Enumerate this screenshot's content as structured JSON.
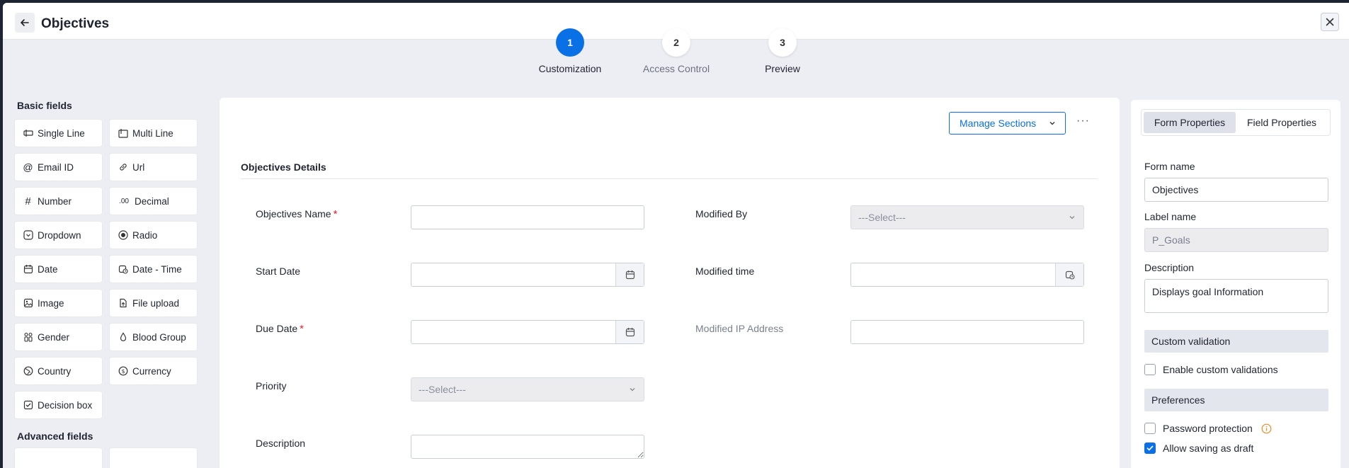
{
  "header": {
    "title": "Objectives"
  },
  "stepper": [
    {
      "number": "1",
      "label": "Customization",
      "state": "active"
    },
    {
      "number": "2",
      "label": "Access Control",
      "state": "inactive"
    },
    {
      "number": "3",
      "label": "Preview",
      "state": "inactive"
    }
  ],
  "left_panel": {
    "basic_title": "Basic fields",
    "advanced_title": "Advanced fields",
    "fields": [
      {
        "label": "Single Line",
        "icon": "single-line-icon"
      },
      {
        "label": "Multi Line",
        "icon": "multi-line-icon"
      },
      {
        "label": "Email ID",
        "icon": "at-icon"
      },
      {
        "label": "Url",
        "icon": "link-icon"
      },
      {
        "label": "Number",
        "icon": "hash-icon"
      },
      {
        "label": "Decimal",
        "icon": "decimal-icon"
      },
      {
        "label": "Dropdown",
        "icon": "dropdown-icon"
      },
      {
        "label": "Radio",
        "icon": "radio-icon"
      },
      {
        "label": "Date",
        "icon": "calendar-icon"
      },
      {
        "label": "Date - Time",
        "icon": "calendar-clock-icon"
      },
      {
        "label": "Image",
        "icon": "image-icon"
      },
      {
        "label": "File upload",
        "icon": "file-upload-icon"
      },
      {
        "label": "Gender",
        "icon": "gender-icon"
      },
      {
        "label": "Blood Group",
        "icon": "drop-icon"
      },
      {
        "label": "Country",
        "icon": "globe-icon"
      },
      {
        "label": "Currency",
        "icon": "currency-icon"
      },
      {
        "label": "Decision box",
        "icon": "checkbox-icon"
      }
    ]
  },
  "form": {
    "manage_sections_label": "Manage Sections",
    "more_label": "···",
    "section_title": "Objectives Details",
    "fields": {
      "objectives_name": "Objectives Name",
      "start_date": "Start Date",
      "due_date": "Due Date",
      "priority": "Priority",
      "description": "Description",
      "modified_by": "Modified By",
      "modified_time": "Modified time",
      "modified_ip": "Modified IP Address"
    },
    "select_placeholder": "---Select---",
    "required_mark": "*"
  },
  "right_panel": {
    "tab_form": "Form Properties",
    "tab_field": "Field Properties",
    "form_name_label": "Form name",
    "form_name_value": "Objectives",
    "label_name_label": "Label name",
    "label_name_value": "P_Goals",
    "description_label": "Description",
    "description_value": "Displays goal Information",
    "custom_validation_title": "Custom validation",
    "enable_custom_validations": "Enable custom validations",
    "preferences_title": "Preferences",
    "password_protection": "Password protection",
    "allow_saving_as_draft": "Allow saving as draft",
    "allow_saving_as_draft_checked": true,
    "password_protection_checked": false,
    "enable_custom_validations_checked": false
  },
  "colors": {
    "accent": "#0a70e6",
    "required": "#e5202e",
    "info": "#f08a24"
  }
}
